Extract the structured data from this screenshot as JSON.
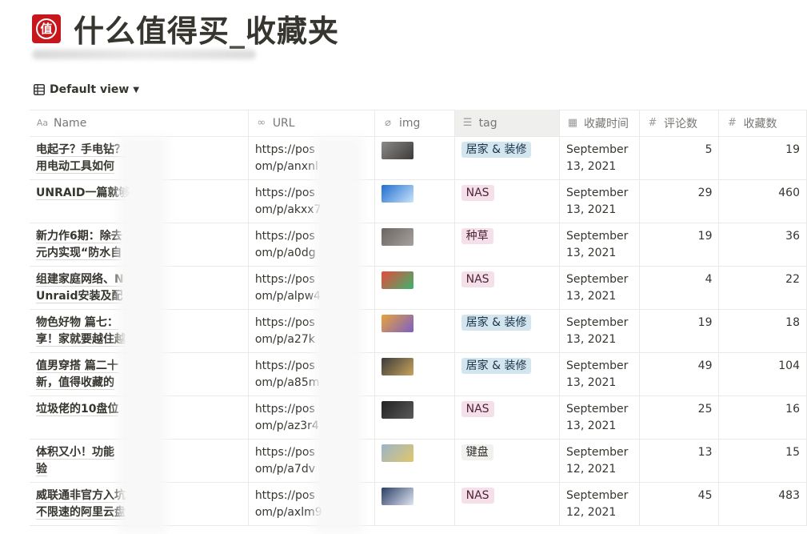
{
  "page": {
    "title": "什么值得买_收藏夹",
    "logo_char": "值"
  },
  "view": {
    "label": "Default view"
  },
  "columns": [
    {
      "key": "name",
      "label": "Name",
      "icon": "Aa"
    },
    {
      "key": "url",
      "label": "URL",
      "icon": "link-icon"
    },
    {
      "key": "img",
      "label": "img",
      "icon": "paperclip-icon"
    },
    {
      "key": "tag",
      "label": "tag",
      "icon": "list-icon"
    },
    {
      "key": "time",
      "label": "收藏时间",
      "icon": "calendar-icon"
    },
    {
      "key": "comments",
      "label": "评论数",
      "icon": "hash-icon"
    },
    {
      "key": "favs",
      "label": "收藏数",
      "icon": "hash-icon"
    }
  ],
  "tag_colors": {
    "居家 & 装修": {
      "bg": "#d3e5ef",
      "fg": "#183347"
    },
    "NAS": {
      "bg": "#f5e0e9",
      "fg": "#4c2337"
    },
    "种草": {
      "bg": "#f5e0e9",
      "fg": "#4c2337"
    },
    "键盘": {
      "bg": "#f1f1ef",
      "fg": "#32302c"
    }
  },
  "rows": [
    {
      "name": "电起子？手电钻？\n用电动工具如何",
      "url": "https://pos\nom/p/anxnl",
      "tag": "居家 & 装修",
      "date1": "September",
      "date2": "13, 2021",
      "comments": "5",
      "favs": "19",
      "thumb": [
        "#8b8a88",
        "#3c3b39"
      ]
    },
    {
      "name": "UNRAID一篇就够",
      "url": "https://pos\nom/p/akxx7",
      "tag": "NAS",
      "date1": "September",
      "date2": "13, 2021",
      "comments": "29",
      "favs": "460",
      "thumb": [
        "#1f6fd1",
        "#c9e3f8"
      ]
    },
    {
      "name": "新力作6期：除去\n元内实现“防水自",
      "url": "https://pos\nom/p/a0dg",
      "tag": "种草",
      "date1": "September",
      "date2": "13, 2021",
      "comments": "19",
      "favs": "36",
      "thumb": [
        "#6a6562",
        "#a7a19c"
      ]
    },
    {
      "name": "组建家庭网络、N\nUnraid安装及配",
      "url": "https://pos\nom/p/alpw4",
      "tag": "NAS",
      "date1": "September",
      "date2": "13, 2021",
      "comments": "4",
      "favs": "22",
      "thumb": [
        "#e64a3b",
        "#3cb46e"
      ]
    },
    {
      "name": "物色好物 篇七：\n享！家就要越住越",
      "url": "https://pos\nom/p/a27k",
      "tag": "居家 & 装修",
      "date1": "September",
      "date2": "13, 2021",
      "comments": "19",
      "favs": "18",
      "thumb": [
        "#e8a33a",
        "#7b5fc7"
      ]
    },
    {
      "name": "值男穿搭 篇二十\n新，值得收藏的",
      "url": "https://pos\nom/p/a85m",
      "tag": "居家 & 装修",
      "date1": "September",
      "date2": "13, 2021",
      "comments": "49",
      "favs": "104",
      "thumb": [
        "#3a3a3a",
        "#c9a55c"
      ]
    },
    {
      "name": "垃圾佬的10盘位",
      "url": "https://pos\nom/p/az3r4",
      "tag": "NAS",
      "date1": "September",
      "date2": "13, 2021",
      "comments": "25",
      "favs": "16",
      "thumb": [
        "#222222",
        "#5a5a5a"
      ]
    },
    {
      "name": "体积又小！功能\n验",
      "url": "https://pos\nom/p/a7dv",
      "tag": "键盘",
      "date1": "September",
      "date2": "12, 2021",
      "comments": "13",
      "favs": "15",
      "thumb": [
        "#9bb4c9",
        "#e0c76b"
      ]
    },
    {
      "name": "威联通非官方入坑\n不限速的阿里云盘",
      "url": "https://pos\nom/p/axlm9",
      "tag": "NAS",
      "date1": "September",
      "date2": "12, 2021",
      "comments": "45",
      "favs": "483",
      "thumb": [
        "#2c3e66",
        "#dfe6f2"
      ]
    }
  ]
}
